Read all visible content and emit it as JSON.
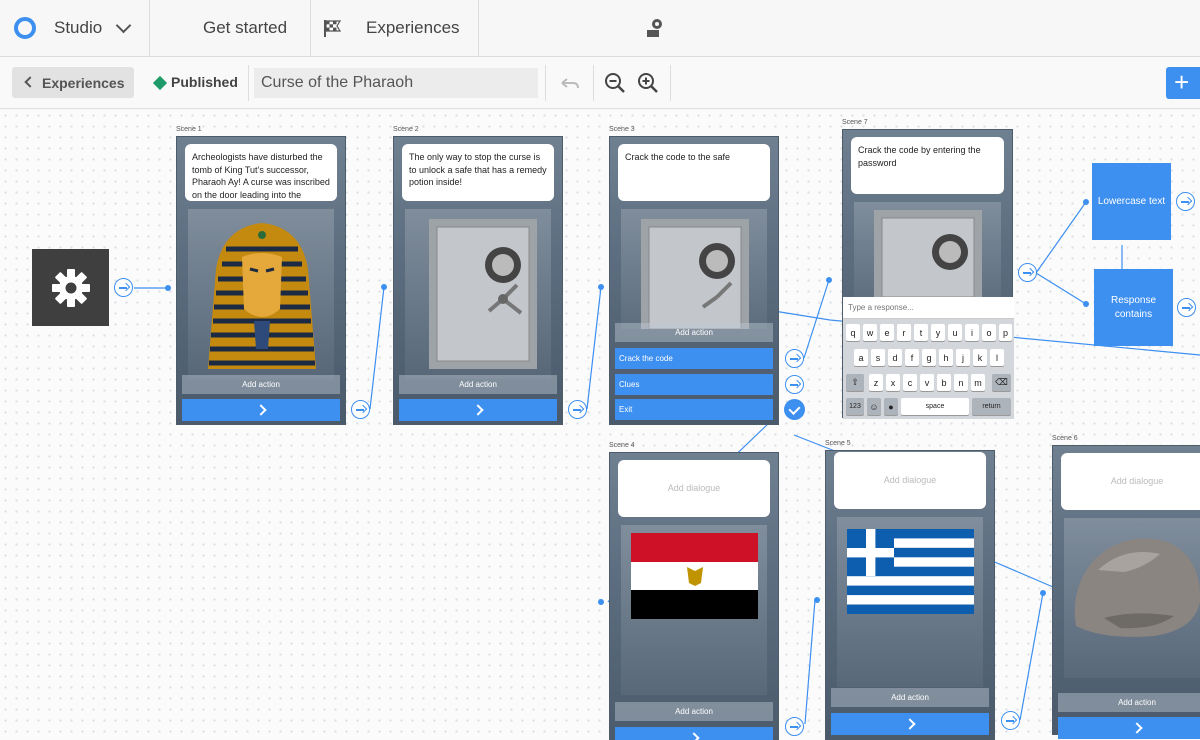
{
  "nav": {
    "app_label": "Studio",
    "items": [
      {
        "label": "Get started",
        "icon": "checkered-flag-icon"
      },
      {
        "label": "Experiences",
        "icon": "experiences-icon"
      }
    ]
  },
  "toolbar": {
    "back_label": "Experiences",
    "status": "Published",
    "title": "Curse of the Pharaoh",
    "accent": "#3d8ff0",
    "status_color": "#1e9b68"
  },
  "scenes": {
    "s1": {
      "label": "Scene 1",
      "dialogue": "Archeologists have disturbed the tomb of King Tut’s successor, Pharaoh Ay! A curse was inscribed on the door leading into the tomb...",
      "image": "pharaoh-mask",
      "add_action": "Add action"
    },
    "s2": {
      "label": "Scene 2",
      "dialogue": "The only way to stop the curse is to unlock a safe that has a remedy potion inside!",
      "image": "safe",
      "add_action": "Add action"
    },
    "s3": {
      "label": "Scene 3",
      "dialogue": "Crack the code to the safe",
      "image": "safe",
      "add_action": "Add action",
      "choices": [
        "Crack the code",
        "Clues",
        "Exit"
      ]
    },
    "s7": {
      "label": "Scene 7",
      "dialogue": "Crack the code by entering the password",
      "image": "safe",
      "response_placeholder": "Type a response..."
    },
    "s4": {
      "label": "Scene 4",
      "dialogue_placeholder": "Add dialogue",
      "image": "egypt-flag",
      "add_action": "Add action"
    },
    "s5": {
      "label": "Scene 5",
      "dialogue_placeholder": "Add dialogue",
      "image": "greece-flag",
      "add_action": "Add action"
    },
    "s6": {
      "label": "Scene 6",
      "dialogue_placeholder": "Add dialogue",
      "image": "boulder",
      "add_action": "Add action"
    }
  },
  "conditions": [
    {
      "label": "Lowercase text"
    },
    {
      "label": "Response contains"
    }
  ],
  "keyboard": {
    "row1": [
      "q",
      "w",
      "e",
      "r",
      "t",
      "y",
      "u",
      "i",
      "o",
      "p"
    ],
    "row2": [
      "a",
      "s",
      "d",
      "f",
      "g",
      "h",
      "j",
      "k",
      "l"
    ],
    "row3": [
      "z",
      "x",
      "c",
      "v",
      "b",
      "n",
      "m"
    ],
    "numbers_key": "123",
    "space_key": "space",
    "return_key": "return"
  }
}
